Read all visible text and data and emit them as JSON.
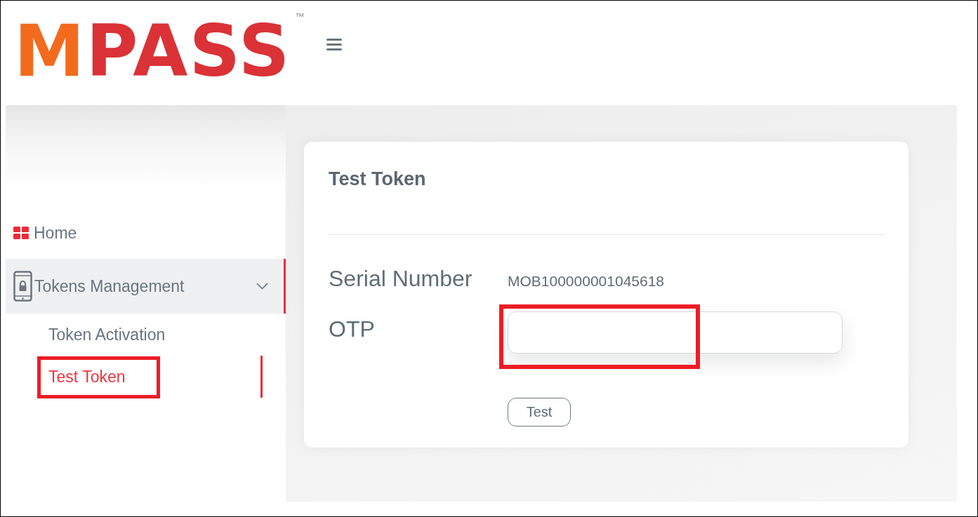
{
  "header": {
    "logo": "MPASS",
    "trademark": "™"
  },
  "sidebar": {
    "items": [
      {
        "label": "Home",
        "kind": "link",
        "selected": false
      },
      {
        "label": "Tokens Management",
        "kind": "group",
        "selected": true,
        "expanded": true,
        "children": [
          {
            "label": "Token Activation",
            "selected": false,
            "highlighted": false
          },
          {
            "label": "Test Token",
            "selected": true,
            "highlighted": true
          }
        ]
      }
    ]
  },
  "card": {
    "title": "Test Token",
    "fields": [
      {
        "label": "Serial Number",
        "kind": "text",
        "value": "MOB100000001045618"
      },
      {
        "label": "OTP",
        "kind": "input",
        "highlighted": true
      }
    ],
    "button": "Test"
  }
}
